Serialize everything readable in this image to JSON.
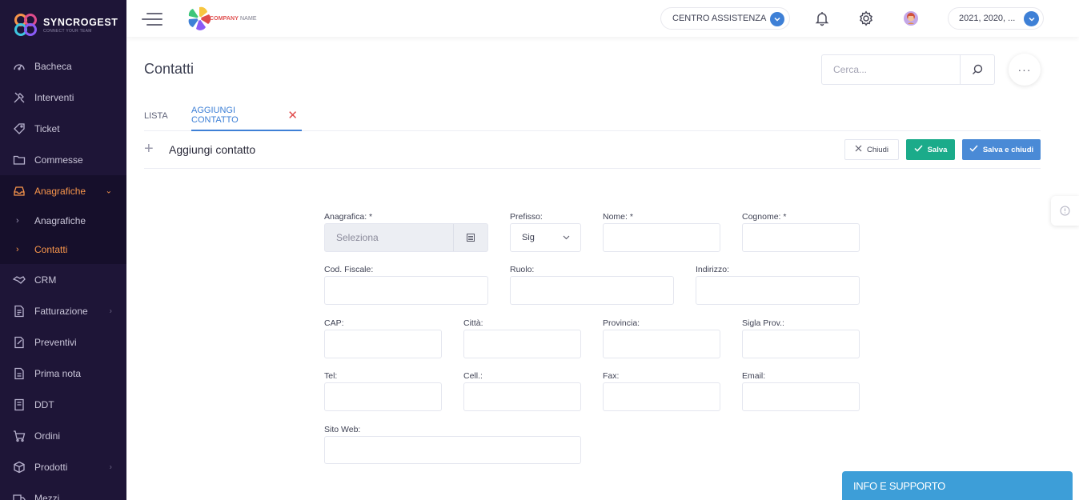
{
  "brand": {
    "name": "SYNCROGEST",
    "tagline": "CONNECT YOUR TEAM",
    "icon": "syncrogest-logo"
  },
  "sidebar": {
    "items": [
      {
        "label": "Bacheca",
        "icon": "dashboard-gauge-icon"
      },
      {
        "label": "Interventi",
        "icon": "tools-icon"
      },
      {
        "label": "Ticket",
        "icon": "tag-icon"
      },
      {
        "label": "Commesse",
        "icon": "folder-icon"
      },
      {
        "label": "Anagrafiche",
        "icon": "inbox-tray-icon",
        "expanded": true,
        "children": [
          {
            "label": "Anagrafiche"
          },
          {
            "label": "Contatti",
            "current": true
          }
        ]
      },
      {
        "label": "CRM",
        "icon": "handshake-icon"
      },
      {
        "label": "Fatturazione",
        "icon": "invoice-icon",
        "has_children": true
      },
      {
        "label": "Preventivi",
        "icon": "quote-ticket-icon"
      },
      {
        "label": "Prima nota",
        "icon": "notes-icon"
      },
      {
        "label": "DDT",
        "icon": "document-icon"
      },
      {
        "label": "Ordini",
        "icon": "cart-icon"
      },
      {
        "label": "Prodotti",
        "icon": "box-icon",
        "has_children": true
      },
      {
        "label": "Mezzi",
        "icon": "truck-icon"
      }
    ]
  },
  "topbar": {
    "company_logo_text_1": "COMPANY",
    "company_logo_text_2": "NAME",
    "assist_label": "CENTRO ASSISTENZA",
    "years_label": "2021, 2020, ...",
    "accent": "#3e80d6"
  },
  "page": {
    "title": "Contatti",
    "search_placeholder": "Cerca...",
    "more_label": "···"
  },
  "tabs": [
    {
      "label": "LISTA",
      "active": false
    },
    {
      "label": "AGGIUNGI CONTATTO",
      "active": true,
      "close": "✕"
    }
  ],
  "form": {
    "heading": "Aggiungi contatto",
    "plus": "+",
    "buttons": {
      "close": "Chiudi",
      "save": "Salva",
      "save_close": "Salva e chiudi"
    },
    "fields": {
      "anagrafica": {
        "label": "Anagrafica: *",
        "placeholder": "Seleziona"
      },
      "prefisso": {
        "label": "Prefisso:",
        "value": "Sig"
      },
      "nome": {
        "label": "Nome: *",
        "value": ""
      },
      "cognome": {
        "label": "Cognome: *",
        "value": ""
      },
      "cod_fiscale": {
        "label": "Cod. Fiscale:",
        "value": ""
      },
      "ruolo": {
        "label": "Ruolo:",
        "value": ""
      },
      "indirizzo": {
        "label": "Indirizzo:",
        "value": ""
      },
      "cap": {
        "label": "CAP:",
        "value": ""
      },
      "citta": {
        "label": "Città:",
        "value": ""
      },
      "provincia": {
        "label": "Provincia:",
        "value": ""
      },
      "sigla_prov": {
        "label": "Sigla Prov.:",
        "value": ""
      },
      "tel": {
        "label": "Tel:",
        "value": ""
      },
      "cell": {
        "label": "Cell.:",
        "value": ""
      },
      "fax": {
        "label": "Fax:",
        "value": ""
      },
      "email": {
        "label": "Email:",
        "value": ""
      },
      "sito_web": {
        "label": "Sito Web:",
        "value": ""
      }
    }
  },
  "info_panel": {
    "label": "INFO E SUPPORTO"
  },
  "colors": {
    "sidebar_bg": "#1e1537",
    "active_orange": "#f7954b",
    "save_green": "#1bab8a",
    "save_close_blue": "#4a8ad6",
    "info_blue": "#3d9ed8"
  }
}
